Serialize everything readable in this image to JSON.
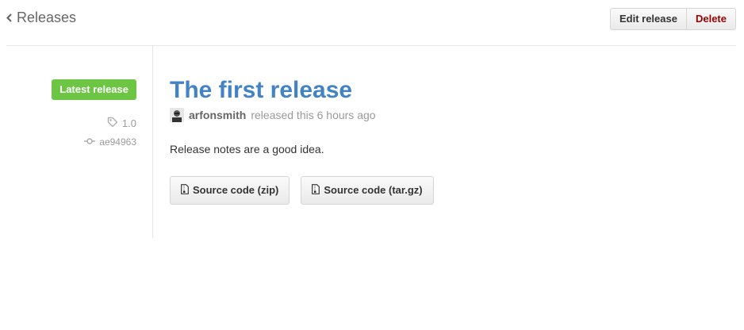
{
  "header": {
    "back_label": "Releases",
    "edit_label": "Edit release",
    "delete_label": "Delete"
  },
  "sidebar": {
    "badge": "Latest release",
    "tag": "1.0",
    "commit": "ae94963",
    "colors": {
      "badge": "#6cc644"
    }
  },
  "release": {
    "title": "The first release",
    "author": "arfonsmith",
    "released_text": "released this 6 hours ago",
    "notes": "Release notes are a good idea.",
    "downloads": [
      {
        "label": "Source code (zip)",
        "icon": "file-zip-icon"
      },
      {
        "label": "Source code (tar.gz)",
        "icon": "file-zip-icon"
      }
    ],
    "colors": {
      "title": "#4183c4",
      "delete": "#990000"
    }
  }
}
